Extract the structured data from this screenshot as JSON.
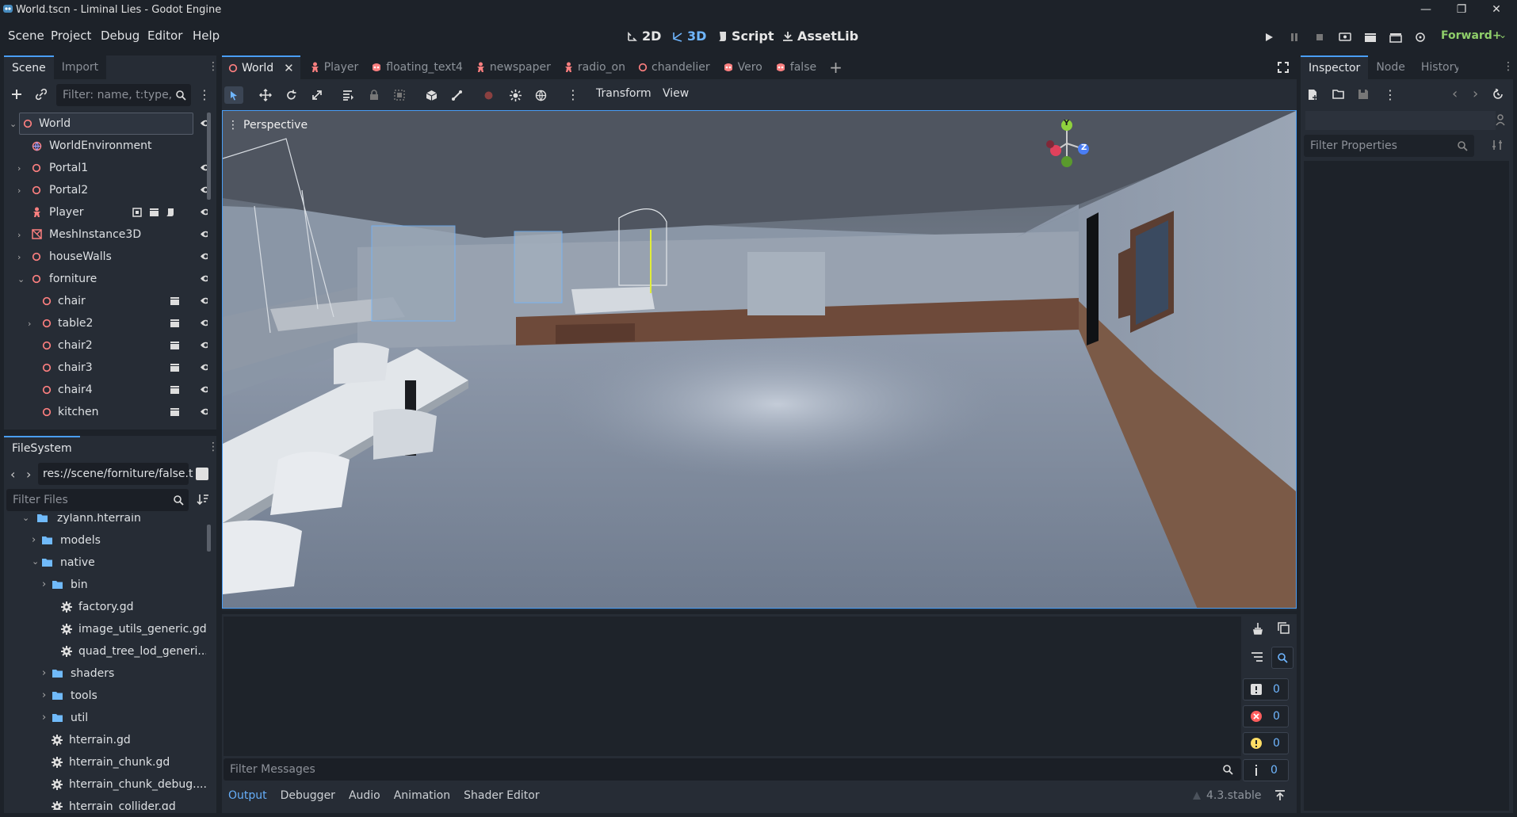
{
  "window": {
    "title": "World.tscn - Liminal Lies - Godot Engine"
  },
  "menu": {
    "items": [
      "Scene",
      "Project",
      "Debug",
      "Editor",
      "Help"
    ]
  },
  "modes": {
    "two_d": "2D",
    "three_d": "3D",
    "script": "Script",
    "assetlib": "AssetLib"
  },
  "renderer": "Forward+",
  "scene_dock": {
    "tabs": [
      "Scene",
      "Import"
    ],
    "filter_placeholder": "Filter: name, t:type,",
    "tree": [
      {
        "label": "World",
        "icon": "node3d-icon"
      },
      {
        "label": "WorldEnvironment",
        "icon": "world-environment-icon"
      },
      {
        "label": "Portal1",
        "icon": "node3d-icon"
      },
      {
        "label": "Portal2",
        "icon": "node3d-icon"
      },
      {
        "label": "Player",
        "icon": "character-body-icon"
      },
      {
        "label": "MeshInstance3D",
        "icon": "mesh-instance-icon"
      },
      {
        "label": "houseWalls",
        "icon": "node3d-icon"
      },
      {
        "label": "forniture",
        "icon": "node3d-icon"
      },
      {
        "label": "chair",
        "icon": "node3d-icon"
      },
      {
        "label": "table2",
        "icon": "node3d-icon"
      },
      {
        "label": "chair2",
        "icon": "node3d-icon"
      },
      {
        "label": "chair3",
        "icon": "node3d-icon"
      },
      {
        "label": "chair4",
        "icon": "node3d-icon"
      },
      {
        "label": "kitchen",
        "icon": "node3d-icon"
      }
    ]
  },
  "filesystem": {
    "tab": "FileSystem",
    "path": "res://scene/forniture/false.t",
    "filter_placeholder": "Filter Files",
    "rows": [
      {
        "label": "zylann.hterrain",
        "type": "folder"
      },
      {
        "label": "models",
        "type": "folder"
      },
      {
        "label": "native",
        "type": "folder"
      },
      {
        "label": "bin",
        "type": "folder"
      },
      {
        "label": "factory.gd",
        "type": "file"
      },
      {
        "label": "image_utils_generic.gd",
        "type": "file"
      },
      {
        "label": "quad_tree_lod_generi...",
        "type": "file"
      },
      {
        "label": "shaders",
        "type": "folder"
      },
      {
        "label": "tools",
        "type": "folder"
      },
      {
        "label": "util",
        "type": "folder"
      },
      {
        "label": "hterrain.gd",
        "type": "file"
      },
      {
        "label": "hterrain_chunk.gd",
        "type": "file"
      },
      {
        "label": "hterrain_chunk_debug....",
        "type": "file"
      },
      {
        "label": "hterrain_collider.gd",
        "type": "file"
      }
    ]
  },
  "scene_tabs": [
    {
      "label": "World",
      "icon": "node3d-icon",
      "color": "#fc7f7f"
    },
    {
      "label": "Player",
      "icon": "character-body-icon",
      "color": "#fc7f7f"
    },
    {
      "label": "floating_text4",
      "icon": "scene-icon",
      "color": "#fc7f7f"
    },
    {
      "label": "newspaper",
      "icon": "character-body-icon",
      "color": "#fc7f7f"
    },
    {
      "label": "radio_on",
      "icon": "character-body-icon",
      "color": "#fc7f7f"
    },
    {
      "label": "chandelier",
      "icon": "node3d-icon",
      "color": "#fc7f7f"
    },
    {
      "label": "Vero",
      "icon": "scene-icon",
      "color": "#fc7f7f"
    },
    {
      "label": "false",
      "icon": "scene-icon",
      "color": "#fc7f7f"
    }
  ],
  "viewport_toolbar": {
    "transform": "Transform",
    "view": "View"
  },
  "viewport": {
    "label": "Perspective",
    "gizmo": {
      "y": "Y",
      "z": "Z"
    }
  },
  "inspector": {
    "tabs": [
      "Inspector",
      "Node",
      "History"
    ],
    "filter_placeholder": "Filter Properties"
  },
  "output": {
    "filter_placeholder": "Filter Messages",
    "counters": {
      "messages": "0",
      "errors": "0",
      "warnings": "0",
      "info": "0"
    }
  },
  "bottom_tabs": [
    "Output",
    "Debugger",
    "Audio",
    "Animation",
    "Shader Editor"
  ],
  "version": "4.3.stable",
  "colors": {
    "accent": "#4a9ef5",
    "node_red": "#fc7f7f",
    "folder_blue": "#70bafa"
  }
}
